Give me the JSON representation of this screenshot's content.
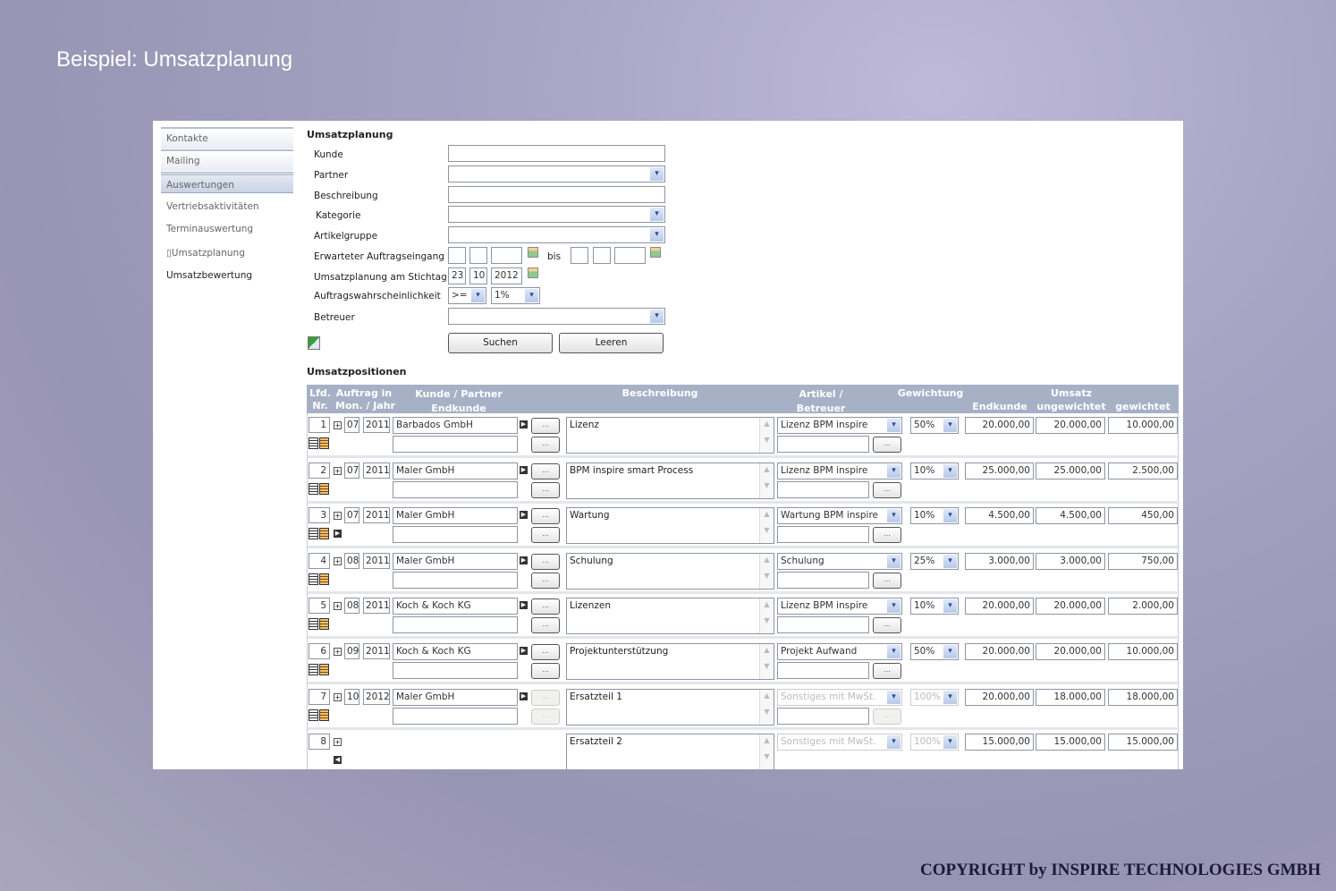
{
  "slide_title": "Beispiel: Umsatzplanung",
  "copyright": "COPYRIGHT by INSPIRE TECHNOLOGIES GMBH",
  "nav": {
    "main": [
      "Kontakte",
      "Mailing",
      "Auswertungen"
    ],
    "sub": [
      "Vertriebsaktivitäten",
      "Terminauswertung",
      "Umsatzplanung",
      "Umsatzbewertung"
    ]
  },
  "form": {
    "title": "Umsatzplanung",
    "labels": {
      "kunde": "Kunde",
      "partner": "Partner",
      "beschreibung": "Beschreibung",
      "kategorie": "Kategorie",
      "artikelgruppe": "Artikelgruppe",
      "auftragseingang": "Erwarteter Auftragseingang",
      "bis": "bis",
      "stichtag": "Umsatzplanung am Stichtag",
      "wahrscheinlichkeit": "Auftragswahrscheinlichkeit",
      "betreuer": "Betreuer"
    },
    "stichtag": {
      "day": "23",
      "month": "10",
      "year": "2012"
    },
    "operator": ">=",
    "probability": "1%",
    "search_label": "Suchen",
    "clear_label": "Leeren"
  },
  "table": {
    "title": "Umsatzpositionen",
    "headers": {
      "nr": "Lfd.\nNr.",
      "auftrag": "Auftrag in\nMon. / Jahr",
      "kunde": "Kunde / Partner\nEndkunde",
      "beschreibung": "Beschreibung",
      "artikel": "Artikel /\nBetreuer",
      "gewichtung": "Gewichtung",
      "umsatz": "Umsatz",
      "endkunde": "Endkunde",
      "ungewichtet": "ungewichtet",
      "gewichtet": "gewichtet"
    },
    "rows": [
      {
        "nr": "1",
        "month": "07",
        "year": "2011",
        "kunde": "Barbados GmbH",
        "beschreibung": "Lizenz",
        "artikel": "Lizenz BPM inspire",
        "gewichtung": "50%",
        "endkunde": "20.000,00",
        "ungewichtet": "20.000,00",
        "gewichtet": "10.000,00",
        "disabled": false
      },
      {
        "nr": "2",
        "month": "07",
        "year": "2011",
        "kunde": "Maler GmbH",
        "beschreibung": "BPM inspire smart Process",
        "artikel": "Lizenz BPM inspire",
        "gewichtung": "10%",
        "endkunde": "25.000,00",
        "ungewichtet": "25.000,00",
        "gewichtet": "2.500,00",
        "disabled": false
      },
      {
        "nr": "3",
        "month": "07",
        "year": "2011",
        "kunde": "Maler GmbH",
        "beschreibung": "Wartung",
        "artikel": "Wartung BPM inspire",
        "gewichtung": "10%",
        "endkunde": "4.500,00",
        "ungewichtet": "4.500,00",
        "gewichtet": "450,00",
        "disabled": false,
        "expand": true
      },
      {
        "nr": "4",
        "month": "08",
        "year": "2011",
        "kunde": "Maler GmbH",
        "beschreibung": "Schulung",
        "artikel": "Schulung",
        "gewichtung": "25%",
        "endkunde": "3.000,00",
        "ungewichtet": "3.000,00",
        "gewichtet": "750,00",
        "disabled": false
      },
      {
        "nr": "5",
        "month": "08",
        "year": "2011",
        "kunde": "Koch & Koch KG",
        "beschreibung": "Lizenzen",
        "artikel": "Lizenz BPM inspire",
        "gewichtung": "10%",
        "endkunde": "20.000,00",
        "ungewichtet": "20.000,00",
        "gewichtet": "2.000,00",
        "disabled": false
      },
      {
        "nr": "6",
        "month": "09",
        "year": "2011",
        "kunde": "Koch & Koch KG",
        "beschreibung": "Projektunterstützung",
        "artikel": "Projekt Aufwand",
        "gewichtung": "50%",
        "endkunde": "20.000,00",
        "ungewichtet": "20.000,00",
        "gewichtet": "10.000,00",
        "disabled": false
      },
      {
        "nr": "7",
        "month": "10",
        "year": "2012",
        "kunde": "Maler GmbH",
        "beschreibung": "Ersatzteil 1",
        "artikel": "Sonstiges mit MwSt.",
        "gewichtung": "100%",
        "endkunde": "20.000,00",
        "ungewichtet": "18.000,00",
        "gewichtet": "18.000,00",
        "disabled": true
      },
      {
        "nr": "8",
        "beschreibung": "Ersatzteil 2",
        "artikel": "Sonstiges mit MwSt.",
        "gewichtung": "100%",
        "endkunde": "15.000,00",
        "ungewichtet": "15.000,00",
        "gewichtet": "15.000,00",
        "disabled": true,
        "child": true
      }
    ]
  }
}
